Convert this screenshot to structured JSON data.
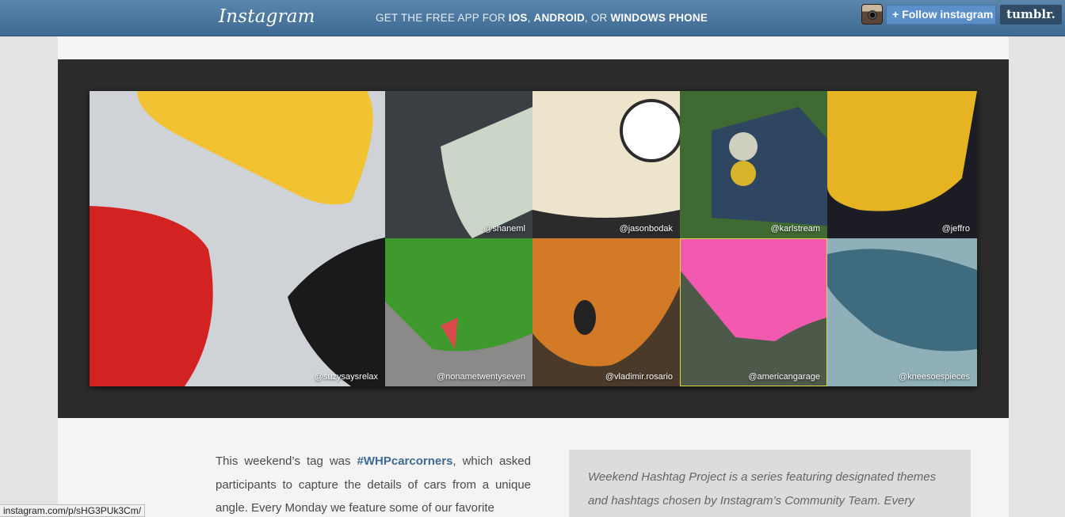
{
  "header": {
    "logo": "Instagram",
    "promo": {
      "prefix": "GET THE FREE APP FOR ",
      "ios": "IOS",
      "sep1": ", ",
      "android": "ANDROID",
      "sep2": ", OR ",
      "windows": "WINDOWS PHONE"
    },
    "follow_plus": "+",
    "follow_label": "Follow instagram",
    "tumblr_label": "tumblr."
  },
  "gallery": {
    "tiles": [
      {
        "caption": "@suzysaysrelax",
        "colors": [
          "#f1c232",
          "#d32222",
          "#1a1a1a",
          "#cfd3d8"
        ]
      },
      {
        "caption": "@shaneml",
        "colors": [
          "#3a3f44",
          "#c9d6c8"
        ]
      },
      {
        "caption": "@jasonbodak",
        "colors": [
          "#ede4cc",
          "#2b2b2b"
        ]
      },
      {
        "caption": "@karlstream",
        "colors": [
          "#3f6b33",
          "#2e4660"
        ]
      },
      {
        "caption": "@jeffro",
        "colors": [
          "#e6b423",
          "#1c1c24"
        ]
      },
      {
        "caption": "@nonametwentyseven",
        "colors": [
          "#3f9a2e",
          "#8a8a88"
        ]
      },
      {
        "caption": "@vladimir.rosario",
        "colors": [
          "#d27a26",
          "#4b3a2a"
        ]
      },
      {
        "caption": "@americangarage",
        "colors": [
          "#f25ab0",
          "#4d5a4a"
        ]
      },
      {
        "caption": "@kneesoespieces",
        "colors": [
          "#3e6c7e",
          "#8fb0b8"
        ]
      }
    ]
  },
  "article": {
    "p1_a": "This weekend’s tag was ",
    "tag": "#WHPcarcorners",
    "p1_b": ", which asked participants to capture the details of cars from a unique angle. Every Monday we feature some of our favorite"
  },
  "sidebar": {
    "text": "Weekend Hashtag Project is a series featuring designated themes and hashtags chosen by Instagram’s Community Team. Every weekend a fun project to take part in and to follow"
  },
  "status_bar": {
    "url": "instagram.com/p/sHG3PUk3Cm/"
  }
}
